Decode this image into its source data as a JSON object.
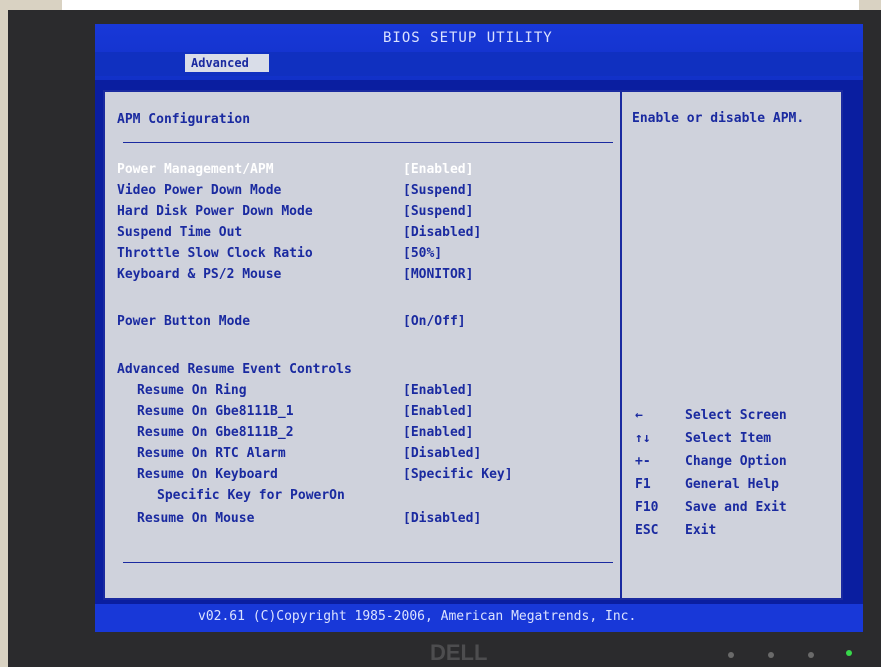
{
  "title": "BIOS SETUP UTILITY",
  "tab": "Advanced",
  "section_title": "APM Configuration",
  "help_text": "Enable or disable APM.",
  "rows": [
    {
      "label": "Power Management/APM",
      "value": "[Enabled]",
      "selected": true
    },
    {
      "label": "Video Power Down Mode",
      "value": "[Suspend]"
    },
    {
      "label": "Hard Disk Power Down Mode",
      "value": "[Suspend]"
    },
    {
      "label": "Suspend Time Out",
      "value": "[Disabled]"
    },
    {
      "label": "Throttle Slow Clock Ratio",
      "value": "[50%]"
    },
    {
      "label": "Keyboard & PS/2 Mouse",
      "value": "[MONITOR]"
    }
  ],
  "power_button": {
    "label": "Power Button Mode",
    "value": "[On/Off]"
  },
  "advanced_resume": {
    "heading": "Advanced Resume Event Controls",
    "items": [
      {
        "label": "Resume On Ring",
        "value": "[Enabled]"
      },
      {
        "label": "Resume On Gbe8111B_1",
        "value": "[Enabled]"
      },
      {
        "label": "Resume On Gbe8111B_2",
        "value": "[Enabled]"
      },
      {
        "label": "Resume On RTC Alarm",
        "value": "[Disabled]"
      },
      {
        "label": "Resume On Keyboard",
        "value": "[Specific Key]"
      },
      {
        "label": "Specific Key for PowerOn",
        "value": ""
      },
      {
        "label": "Resume On Mouse",
        "value": "[Disabled]"
      }
    ]
  },
  "keys": [
    {
      "key": "←",
      "desc": "Select Screen"
    },
    {
      "key": "↑↓",
      "desc": "Select Item"
    },
    {
      "key": "+-",
      "desc": "Change Option"
    },
    {
      "key": "F1",
      "desc": "General Help"
    },
    {
      "key": "F10",
      "desc": "Save and Exit"
    },
    {
      "key": "ESC",
      "desc": "Exit"
    }
  ],
  "copyright": "v02.61 (C)Copyright 1985-2006, American Megatrends, Inc.",
  "brand": "DELL",
  "colors": {
    "screen_bg": "#0a1ea0",
    "panel_bg": "#cfd2dc",
    "text": "#1a2aa0",
    "selected_text": "#ffffff"
  }
}
